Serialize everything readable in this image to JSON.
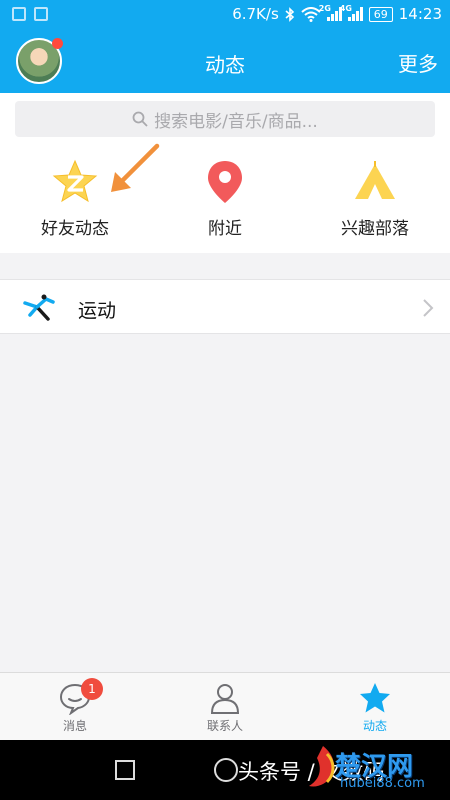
{
  "status_bar": {
    "speed": "6.7K/s",
    "sim1_type": "2G",
    "sim2_type": "4G",
    "battery": "69",
    "time": "14:23"
  },
  "header": {
    "title": "动态",
    "more_label": "更多"
  },
  "search": {
    "placeholder": "搜索电影/音乐/商品..."
  },
  "quick_entries": [
    {
      "label": "好友动态",
      "icon": "star-z-icon"
    },
    {
      "label": "附近",
      "icon": "location-pin-icon"
    },
    {
      "label": "兴趣部落",
      "icon": "tent-icon"
    }
  ],
  "list": [
    {
      "label": "运动",
      "icon": "running-icon"
    }
  ],
  "tabbar": {
    "tabs": [
      {
        "label": "消息",
        "icon": "chat-bubble-icon",
        "badge": "1",
        "active": false
      },
      {
        "label": "联系人",
        "icon": "person-icon",
        "active": false
      },
      {
        "label": "动态",
        "icon": "star-icon",
        "active": true
      }
    ]
  },
  "watermark": {
    "text": "头条号 / 文数码",
    "brand": "楚汉网",
    "domain": "hubei88.com"
  },
  "colors": {
    "accent": "#12aaf0",
    "badge": "#f04c3e",
    "arrow": "#f1913c"
  }
}
